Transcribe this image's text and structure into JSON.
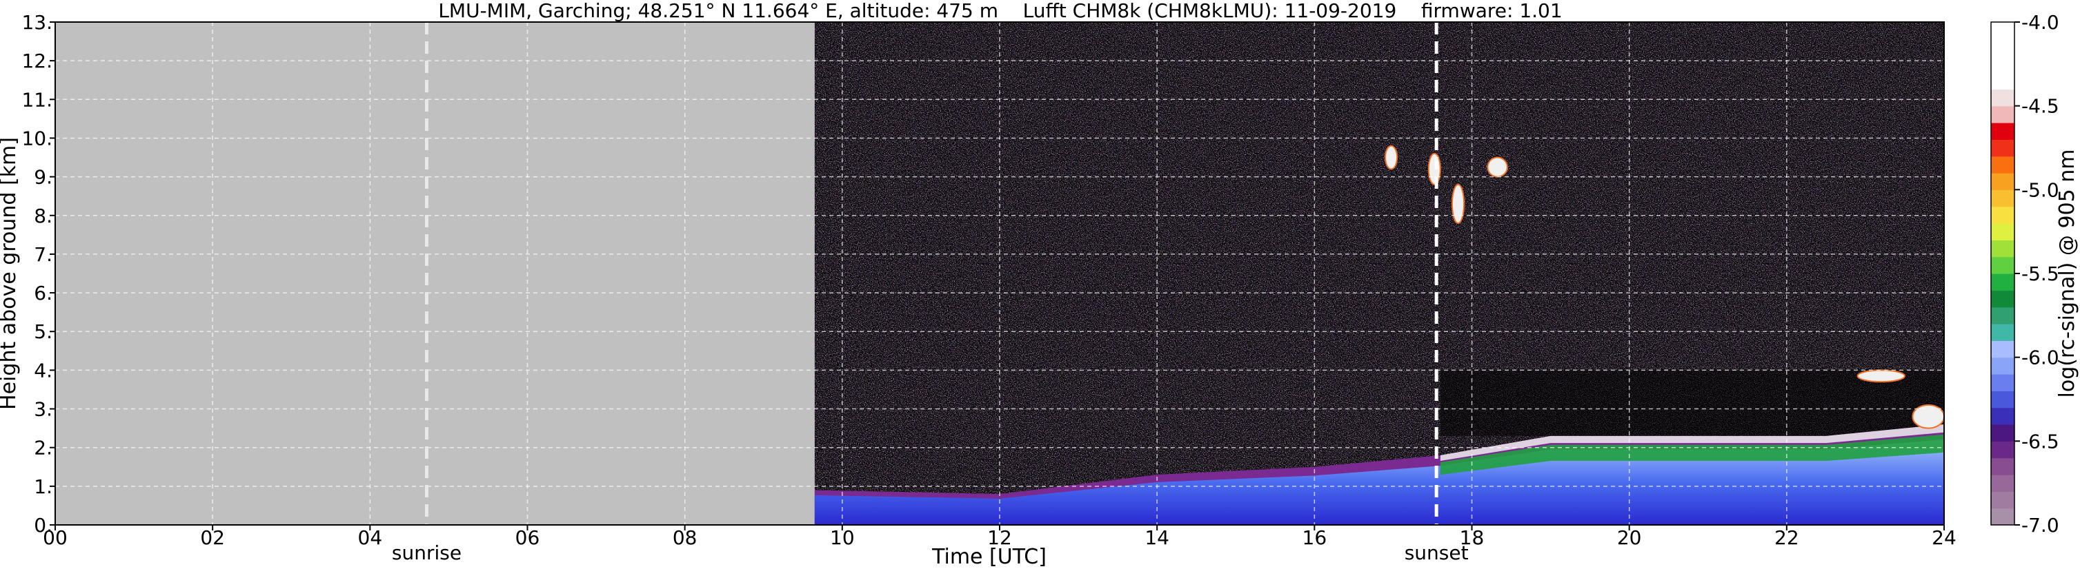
{
  "title": "LMU-MIM, Garching; 48.251° N 11.664° E, altitude: 475 m    Lufft CHM8k (CHM8kLMU): 11-09-2019    firmware: 1.01",
  "chart_data": {
    "type": "heatmap",
    "xlabel": "Time [UTC]",
    "ylabel": "Height above ground [km]",
    "xlim": [
      0,
      24
    ],
    "ylim": [
      0,
      13
    ],
    "x_ticks": [
      "00",
      "02",
      "04",
      "06",
      "08",
      "10",
      "12",
      "14",
      "16",
      "18",
      "20",
      "22",
      "24"
    ],
    "y_ticks": [
      "0.",
      "1.",
      "2.",
      "3.",
      "4.",
      "5.",
      "6.",
      "7.",
      "8.",
      "9.",
      "10.",
      "11.",
      "12.",
      "13."
    ],
    "grid": true,
    "no_data_until_hour": 9.65,
    "markers": [
      {
        "label": "sunrise",
        "hour": 4.72
      },
      {
        "label": "sunset",
        "hour": 17.55
      }
    ],
    "aerosol_layer": [
      {
        "hour": 9.65,
        "top_km": 0.9
      },
      {
        "hour": 12,
        "top_km": 0.8
      },
      {
        "hour": 14,
        "top_km": 1.3
      },
      {
        "hour": 16,
        "top_km": 1.5
      },
      {
        "hour": 17.6,
        "top_km": 1.8
      },
      {
        "hour": 19,
        "top_km": 2.3
      },
      {
        "hour": 21,
        "top_km": 2.3
      },
      {
        "hour": 22.5,
        "top_km": 2.3
      },
      {
        "hour": 24,
        "top_km": 2.6
      }
    ],
    "cloud_features": [
      {
        "hour_start": 16.9,
        "hour_end": 17.05,
        "base_km": 9.2,
        "top_km": 9.8
      },
      {
        "hour_start": 17.45,
        "hour_end": 17.6,
        "base_km": 8.8,
        "top_km": 9.6
      },
      {
        "hour_start": 17.75,
        "hour_end": 17.9,
        "base_km": 7.8,
        "top_km": 8.8
      },
      {
        "hour_start": 18.2,
        "hour_end": 18.45,
        "base_km": 9.0,
        "top_km": 9.5
      },
      {
        "hour_start": 22.9,
        "hour_end": 23.5,
        "base_km": 3.7,
        "top_km": 4.0
      },
      {
        "hour_start": 23.6,
        "hour_end": 24.0,
        "base_km": 2.5,
        "top_km": 3.1
      }
    ],
    "colorbar": {
      "label": "log(rc-signal) @ 905 nm",
      "range": [
        -7.0,
        -4.0
      ],
      "ticks": [
        "-4.0",
        "-4.5",
        "-5.0",
        "-5.5",
        "-6.0",
        "-6.5",
        "-7.0"
      ],
      "colors": [
        "#a890a8",
        "#a07ca0",
        "#98689a",
        "#884c90",
        "#6a2888",
        "#4a1880",
        "#3a30b8",
        "#4a58dc",
        "#6a7ef0",
        "#8aa4f8",
        "#a8bcff",
        "#40b8a8",
        "#30a070",
        "#108a38",
        "#20b040",
        "#60d040",
        "#a0e038",
        "#e0f040",
        "#f8e040",
        "#f8c030",
        "#f8a020",
        "#f87010",
        "#f03018",
        "#e00010",
        "#f0b8b8",
        "#f0e0e0",
        "#ffffff",
        "#ffffff",
        "#ffffff",
        "#ffffff"
      ]
    }
  }
}
